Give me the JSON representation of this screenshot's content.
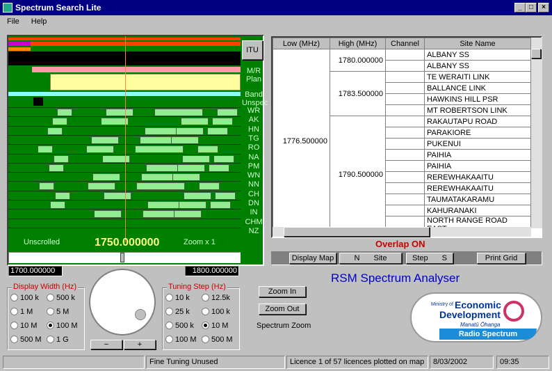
{
  "window": {
    "title": "Spectrum Search Lite",
    "min": "_",
    "max": "□",
    "close": "×"
  },
  "menu": {
    "file": "File",
    "help": "Help"
  },
  "spectrum": {
    "itu": "ITU",
    "mr": "M/R",
    "plan": "Plan",
    "band": "Band",
    "unspec": "Unspec",
    "services": [
      "WR",
      "AK",
      "HN",
      "TG",
      "RO",
      "NA",
      "PM",
      "WN",
      "NN",
      "CH",
      "DN",
      "IN",
      "CHM",
      "NZ"
    ],
    "scroll_state": "Unscrolled",
    "center": "1750.000000",
    "zoom": "Zoom x 1",
    "low": "1700.000000",
    "high": "1800.000000"
  },
  "grid": {
    "headers": [
      "Low (MHz)",
      "High (MHz)",
      "Channel",
      "Site Name"
    ],
    "low": "1776.500000",
    "high1": "1780.000000",
    "high2": "1783.500000",
    "high3": "1790.500000",
    "sites": [
      "ALBANY SS",
      "ALBANY SS",
      "TE WERAITI LINK",
      "BALLANCE LINK",
      "HAWKINS HILL PSR",
      "MT ROBERTSON LINK",
      "RAKAUTAPU ROAD",
      "PARAKIORE",
      "PUKENUI",
      "PAIHIA",
      "PAIHIA",
      "REREWHAKAAITU",
      "REREWHAKAAITU",
      "TAUMATAKARAMU",
      "KAHURANAKI",
      "NORTH RANGE ROAD EAST"
    ]
  },
  "overlap": "Overlap ON",
  "tabs": {
    "display_map": "Display Map",
    "n": "N",
    "site": "Site",
    "step": "Step",
    "s": "S",
    "print_grid": "Print Grid"
  },
  "app_title": "RSM Spectrum Analyser",
  "display_width": {
    "label": "Display Width (Hz)",
    "options": [
      "100 k",
      "500 k",
      "1 M",
      "5 M",
      "10 M",
      "100 M",
      "500 M",
      "1 G"
    ],
    "selected": "100 M"
  },
  "tuning_step": {
    "label": "Tuning Step (Hz)",
    "options": [
      "10 k",
      "12.5k",
      "25 k",
      "100 k",
      "500 k",
      "10 M",
      "100 M",
      "500 M"
    ],
    "selected": "10 M"
  },
  "knob": {
    "minus": "−",
    "plus": "+"
  },
  "zoom": {
    "in": "Zoom In",
    "out": "Zoom Out",
    "label": "Spectrum Zoom"
  },
  "logo": {
    "ministry": "Ministry of",
    "economic": "Economic",
    "development": "Development",
    "maori": "Manatū Ōhanga",
    "rs": "Radio Spectrum"
  },
  "status": {
    "tuning": "Fine Tuning Unused",
    "licence": "Licence  1 of  57 licences plotted on map",
    "date": "8/03/2002",
    "time": "09:35"
  },
  "colors": {
    "title_bg": "#000080",
    "spectrum_bg": "#008000",
    "cell": "#90ee90",
    "overlap": "#cc0000",
    "app_title": "#0000cc"
  }
}
